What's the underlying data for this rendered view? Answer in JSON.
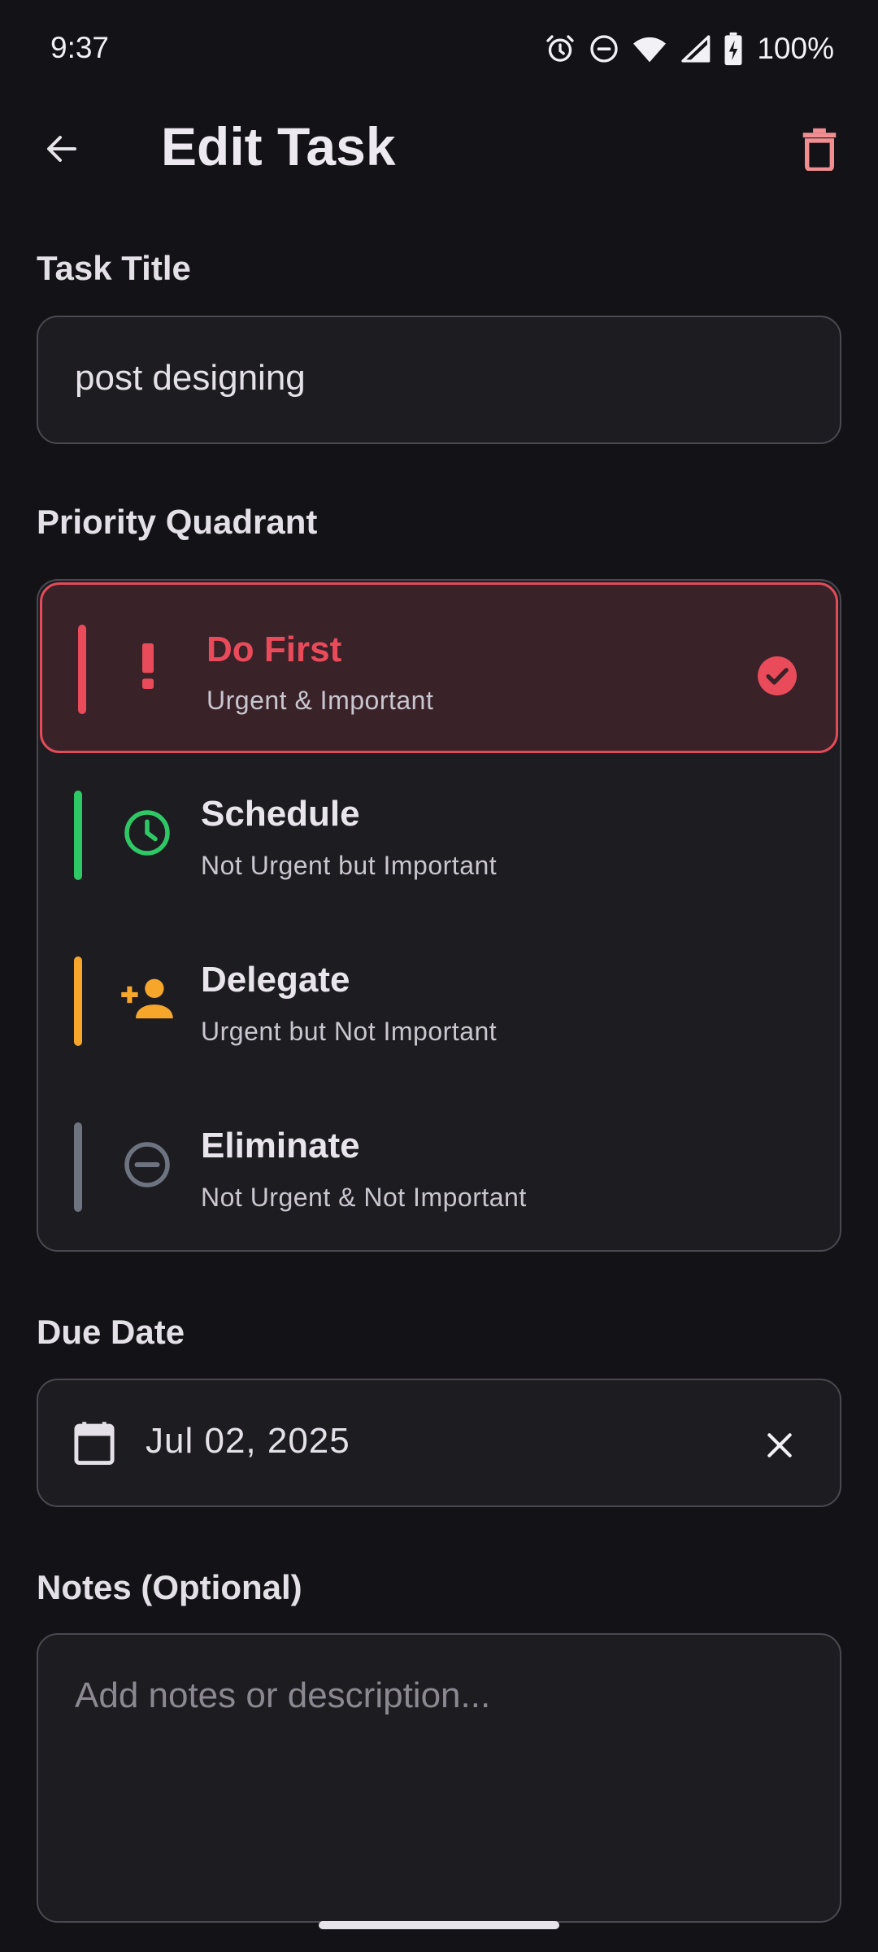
{
  "status_bar": {
    "time": "9:37",
    "battery": "100%",
    "icons": [
      "alarm-icon",
      "do-not-disturb-icon",
      "wifi-icon",
      "signal-icon",
      "battery-charging-icon"
    ]
  },
  "app_bar": {
    "title": "Edit Task",
    "back_icon": "arrow-back-icon",
    "delete_icon": "trash-icon"
  },
  "form": {
    "title_label": "Task Title",
    "title_value": "post designing",
    "priority_label": "Priority Quadrant",
    "quadrants": [
      {
        "title": "Do First",
        "subtitle": "Urgent & Important",
        "icon": "exclamation-icon",
        "color": "#E94B5B",
        "selected": true
      },
      {
        "title": "Schedule",
        "subtitle": "Not Urgent but Important",
        "icon": "clock-icon",
        "color": "#2FC866",
        "selected": false
      },
      {
        "title": "Delegate",
        "subtitle": "Urgent but Not Important",
        "icon": "person-add-icon",
        "color": "#F6A62B",
        "selected": false
      },
      {
        "title": "Eliminate",
        "subtitle": "Not Urgent & Not Important",
        "icon": "minus-circle-icon",
        "color": "#6E7380",
        "selected": false
      }
    ],
    "due_label": "Due Date",
    "due_value": "Jul 02, 2025",
    "notes_label": "Notes (Optional)",
    "notes_placeholder": "Add notes or description..."
  },
  "colors": {
    "background": "#131217",
    "surface": "#1D1C21",
    "outline": "#4A4850",
    "selected_bg": "#3A2229",
    "danger": "#F08E92"
  }
}
